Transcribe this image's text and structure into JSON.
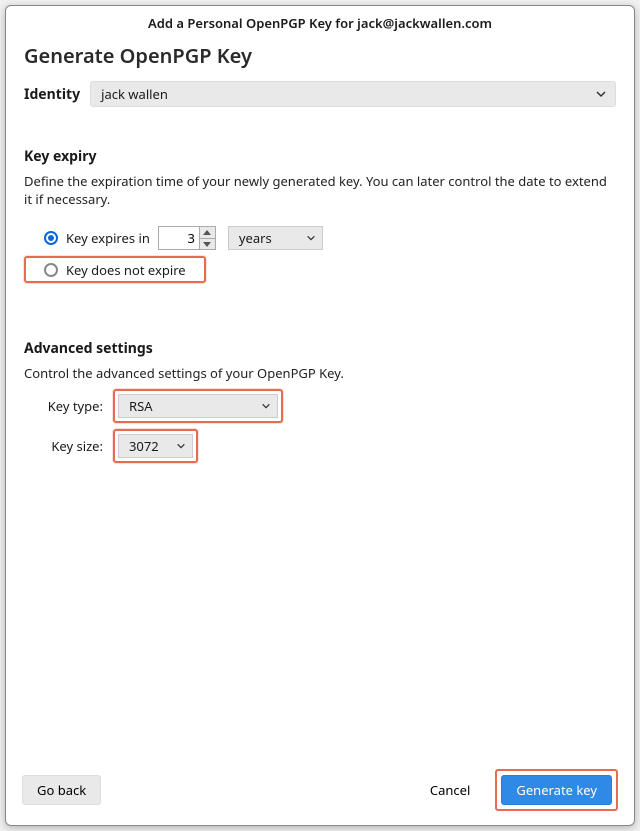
{
  "window": {
    "title": "Add a Personal OpenPGP Key for jack@jackwallen.com"
  },
  "header": {
    "subtitle": "Generate OpenPGP Key"
  },
  "identity": {
    "label": "Identity",
    "value": "jack wallen"
  },
  "expiry": {
    "section_title": "Key expiry",
    "section_desc": "Define the expiration time of your newly generated key. You can later control the date to extend it if necessary.",
    "option_expires_label": "Key expires in",
    "expires_value": "3",
    "units_value": "years",
    "option_noexpire_label": "Key does not expire",
    "selected": "expires"
  },
  "advanced": {
    "section_title": "Advanced settings",
    "section_desc": "Control the advanced settings of your OpenPGP Key.",
    "key_type_label": "Key type:",
    "key_type_value": "RSA",
    "key_size_label": "Key size:",
    "key_size_value": "3072"
  },
  "footer": {
    "go_back": "Go back",
    "cancel": "Cancel",
    "generate": "Generate key"
  }
}
